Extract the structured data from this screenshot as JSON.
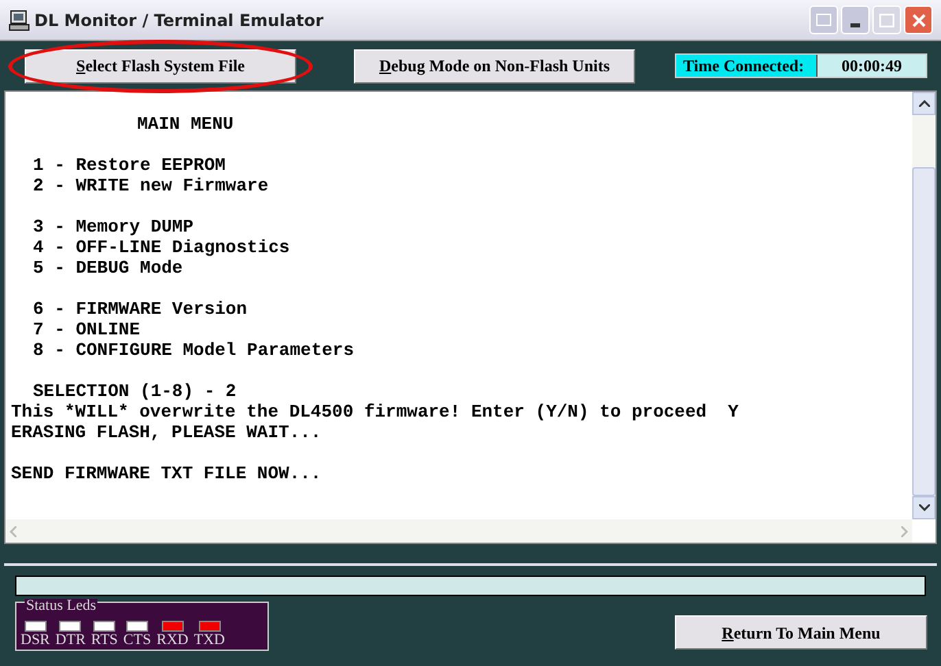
{
  "window": {
    "title": "DL Monitor / Terminal Emulator"
  },
  "toolbar": {
    "buttons": [
      {
        "label": "Select Flash System File",
        "highlighted": true
      },
      {
        "label": "Debug Mode on Non-Flash Units",
        "highlighted": false
      }
    ],
    "time_connected": {
      "label": "Time Connected:",
      "value": "00:00:49"
    }
  },
  "terminal": {
    "blocks": [
      {
        "lines": [
          {
            "kind": "title",
            "text": "MAIN MENU"
          }
        ]
      },
      {
        "lines": [
          {
            "kind": "menu",
            "text": "1 - Restore EEPROM"
          },
          {
            "kind": "menu",
            "text": "2 - WRITE new Firmware"
          }
        ]
      },
      {
        "lines": [
          {
            "kind": "menu",
            "text": "3 - Memory DUMP"
          },
          {
            "kind": "menu",
            "text": "4 - OFF-LINE Diagnostics"
          },
          {
            "kind": "menu",
            "text": "5 - DEBUG Mode"
          }
        ]
      },
      {
        "lines": [
          {
            "kind": "menu",
            "text": "6 - FIRMWARE Version"
          },
          {
            "kind": "menu",
            "text": "7 - ONLINE"
          },
          {
            "kind": "menu",
            "text": "8 - CONFIGURE Model Parameters"
          }
        ]
      },
      {
        "lines": [
          {
            "kind": "menu",
            "text": "SELECTION (1-8) - 2"
          },
          {
            "kind": "plain",
            "text": "This *WILL* overwrite the DL4500 firmware! Enter (Y/N) to proceed  Y"
          },
          {
            "kind": "plain",
            "text": "ERASING FLASH, PLEASE WAIT..."
          }
        ]
      },
      {
        "lines": [
          {
            "kind": "plain",
            "text": "SEND FIRMWARE TXT FILE NOW..."
          }
        ]
      }
    ]
  },
  "progress": {
    "level": 0
  },
  "status_leds": {
    "title": "Status Leds",
    "leds": [
      {
        "label": "DSR",
        "lit": false
      },
      {
        "label": "DTR",
        "lit": false
      },
      {
        "label": "RTS",
        "lit": false
      },
      {
        "label": "CTS",
        "lit": false
      },
      {
        "label": "RXD",
        "lit": true
      },
      {
        "label": "TXD",
        "lit": true
      }
    ]
  },
  "return_button": {
    "label": "Return To Main Menu"
  }
}
